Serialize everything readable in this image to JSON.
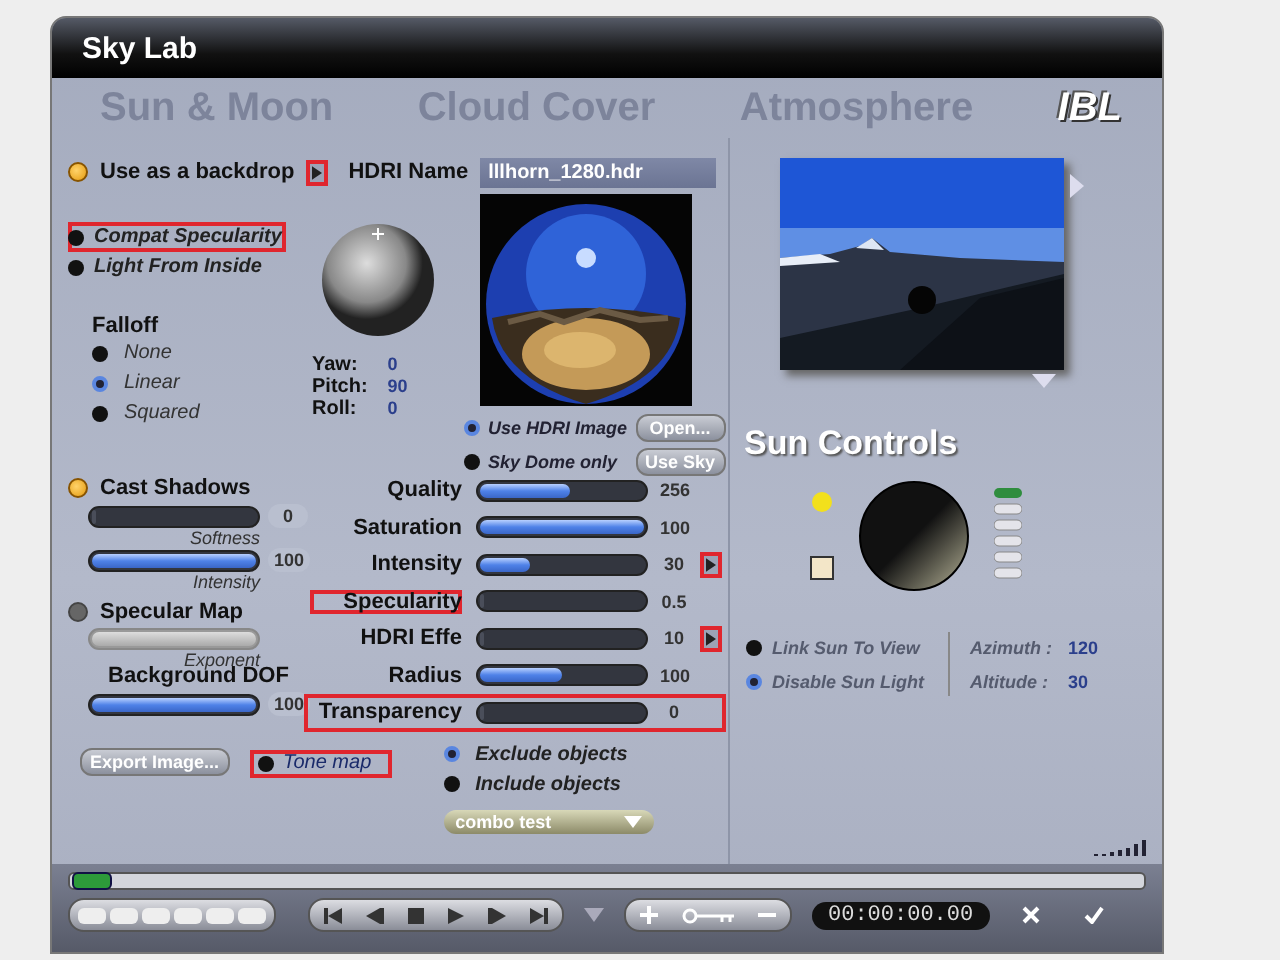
{
  "window": {
    "title": "Sky Lab"
  },
  "tabs": [
    {
      "label": "Sun & Moon",
      "selected": false
    },
    {
      "label": "Cloud Cover",
      "selected": false
    },
    {
      "label": "Atmosphere",
      "selected": false
    },
    {
      "label": "IBL",
      "selected": true
    }
  ],
  "backdrop": {
    "label": "Use as a backdrop",
    "on": true,
    "arrow_highlighted": true
  },
  "hdri_name": {
    "label": "HDRI Name",
    "value": "lllhorn_1280.hdr"
  },
  "options": [
    {
      "label": "Compat Specularity",
      "selected": false,
      "highlighted": true
    },
    {
      "label": "Light From Inside",
      "selected": false,
      "highlighted": false
    }
  ],
  "falloff": {
    "label": "Falloff",
    "options": [
      {
        "label": "None",
        "selected": false
      },
      {
        "label": "Linear",
        "selected": true
      },
      {
        "label": "Squared",
        "selected": false
      }
    ]
  },
  "orientation": [
    {
      "label": "Yaw:",
      "value": "0"
    },
    {
      "label": "Pitch:",
      "value": "90"
    },
    {
      "label": "Roll:",
      "value": "0"
    }
  ],
  "source": {
    "options": [
      {
        "label": "Use HDRI Image",
        "selected": true
      },
      {
        "label": "Sky Dome only",
        "selected": false
      }
    ],
    "buttons": [
      "Open...",
      "Use Sky"
    ]
  },
  "cast_shadows": {
    "label": "Cast Shadows",
    "on": true,
    "sliders": [
      {
        "caption": "Softness",
        "value": "0",
        "level": 0
      },
      {
        "caption": "Intensity",
        "value": "100",
        "level": 1
      }
    ]
  },
  "specular_map": {
    "label": "Specular Map",
    "on": false,
    "slider": {
      "caption": "Exponent",
      "disabled": true,
      "level": 1
    }
  },
  "background_dof": {
    "label": "Background DOF",
    "value": "100",
    "level": 1
  },
  "export_button": "Export Image...",
  "tone_map": {
    "label": "Tone map",
    "selected": false,
    "highlighted": true
  },
  "params": [
    {
      "label": "Quality",
      "value": "256",
      "level": 0.55,
      "arrow": false,
      "label_highlighted": false,
      "row_highlighted": false
    },
    {
      "label": "Saturation",
      "value": "100",
      "level": 1,
      "arrow": false,
      "label_highlighted": false,
      "row_highlighted": false
    },
    {
      "label": "Intensity",
      "value": "30",
      "level": 0.3,
      "arrow": true,
      "label_highlighted": false,
      "row_highlighted": false
    },
    {
      "label": "Specularity",
      "value": "0.5",
      "level": 0,
      "arrow": false,
      "label_highlighted": true,
      "row_highlighted": false
    },
    {
      "label": "HDRI Effe",
      "value": "10",
      "level": 0,
      "arrow": true,
      "label_highlighted": false,
      "row_highlighted": false
    },
    {
      "label": "Radius",
      "value": "100",
      "level": 0.5,
      "arrow": false,
      "label_highlighted": false,
      "row_highlighted": false
    },
    {
      "label": "Transparency",
      "value": "0",
      "level": 0,
      "arrow": false,
      "label_highlighted": false,
      "row_highlighted": true
    }
  ],
  "objects": [
    {
      "label": "Exclude objects",
      "selected": true
    },
    {
      "label": "Include objects",
      "selected": false
    }
  ],
  "combo": {
    "value": "combo test"
  },
  "sun_controls": {
    "title": "Sun Controls",
    "options": [
      {
        "label": "Link Sun To View",
        "selected": false
      },
      {
        "label": "Disable Sun Light",
        "selected": true
      }
    ],
    "readings": [
      {
        "label": "Azimuth :",
        "value": "120"
      },
      {
        "label": "Altitude :",
        "value": "30"
      }
    ]
  },
  "transport": {
    "time": "00:00:00.00"
  }
}
